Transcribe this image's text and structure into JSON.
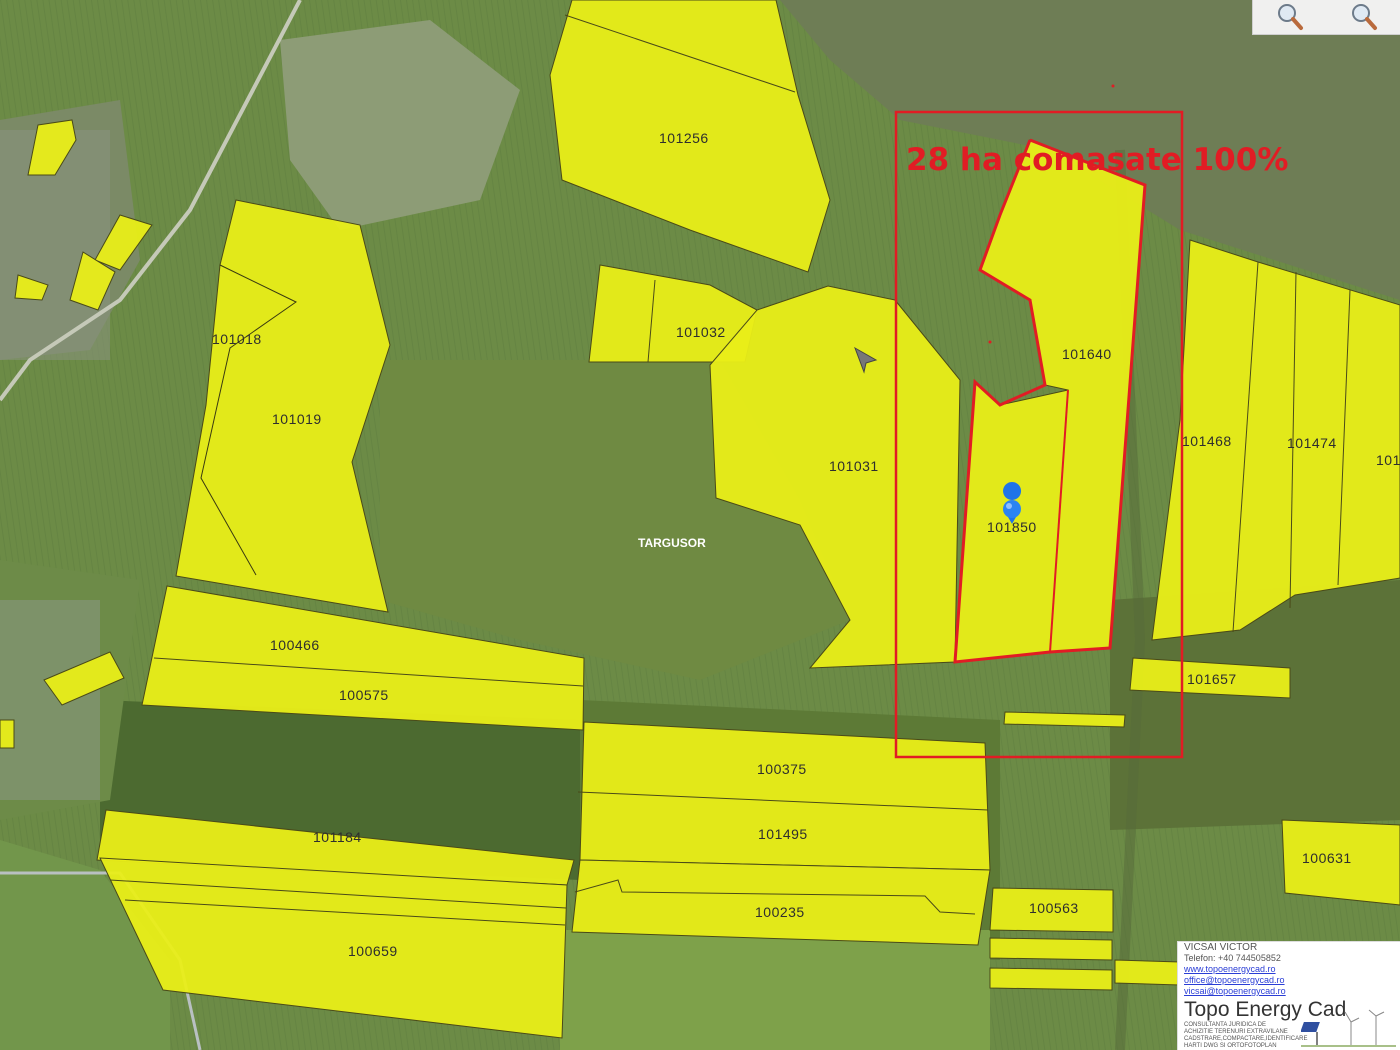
{
  "map": {
    "annotation": "28 ha comasate 100%",
    "locality_label": "TARGUSOR",
    "colors": {
      "parcel_fill": "#e9ee18",
      "highlight": "#e11c24",
      "pin": "#1f74e8",
      "background": "#5f7f3e"
    },
    "parcels": [
      {
        "id": "101256"
      },
      {
        "id": "101018"
      },
      {
        "id": "101019"
      },
      {
        "id": "101032"
      },
      {
        "id": "101031"
      },
      {
        "id": "101640"
      },
      {
        "id": "101850"
      },
      {
        "id": "101468"
      },
      {
        "id": "101474"
      },
      {
        "id": "101"
      },
      {
        "id": "100466"
      },
      {
        "id": "100575"
      },
      {
        "id": "101657"
      },
      {
        "id": "100375"
      },
      {
        "id": "101184"
      },
      {
        "id": "101495"
      },
      {
        "id": "100235"
      },
      {
        "id": "100563"
      },
      {
        "id": "100659"
      },
      {
        "id": "100631"
      }
    ]
  },
  "zoom_controls": {
    "zoom_in_icon": "magnifier-plus-icon",
    "zoom_out_icon": "magnifier-minus-icon"
  },
  "contact_card": {
    "name": "VICSAI VICTOR",
    "phone": "Telefon: +40 744505852",
    "website": "www.topoenergycad.ro",
    "email_office": "office@topoenergycad.ro",
    "email_personal": "vicsai@topoenergycad.ro",
    "brand": "Topo Energy Cad",
    "tagline_1": "CONSULTANTA JURIDICA DE",
    "tagline_2": "ACHIZITIE TERENURI EXTRAVILANE",
    "tagline_3": "CADSTRARE,COMPACTARE,IDENTIFICARE",
    "tagline_4": "HARTI DWG SI ORTOFOTOPLAN"
  }
}
